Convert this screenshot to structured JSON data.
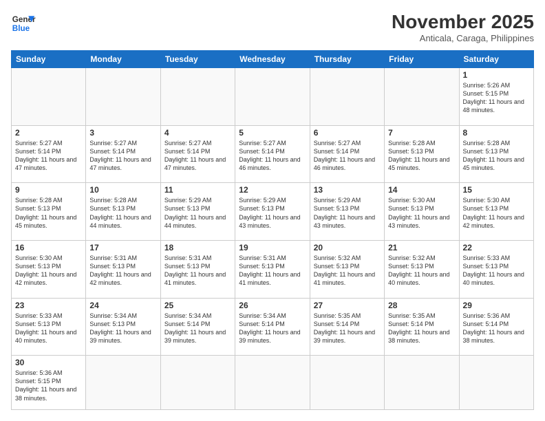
{
  "logo": {
    "line1": "General",
    "line2": "Blue"
  },
  "header": {
    "month": "November 2025",
    "location": "Anticala, Caraga, Philippines"
  },
  "weekdays": [
    "Sunday",
    "Monday",
    "Tuesday",
    "Wednesday",
    "Thursday",
    "Friday",
    "Saturday"
  ],
  "weeks": [
    [
      {
        "day": "",
        "info": ""
      },
      {
        "day": "",
        "info": ""
      },
      {
        "day": "",
        "info": ""
      },
      {
        "day": "",
        "info": ""
      },
      {
        "day": "",
        "info": ""
      },
      {
        "day": "",
        "info": ""
      },
      {
        "day": "1",
        "info": "Sunrise: 5:26 AM\nSunset: 5:15 PM\nDaylight: 11 hours and 48 minutes."
      }
    ],
    [
      {
        "day": "2",
        "info": "Sunrise: 5:27 AM\nSunset: 5:14 PM\nDaylight: 11 hours and 47 minutes."
      },
      {
        "day": "3",
        "info": "Sunrise: 5:27 AM\nSunset: 5:14 PM\nDaylight: 11 hours and 47 minutes."
      },
      {
        "day": "4",
        "info": "Sunrise: 5:27 AM\nSunset: 5:14 PM\nDaylight: 11 hours and 47 minutes."
      },
      {
        "day": "5",
        "info": "Sunrise: 5:27 AM\nSunset: 5:14 PM\nDaylight: 11 hours and 46 minutes."
      },
      {
        "day": "6",
        "info": "Sunrise: 5:27 AM\nSunset: 5:14 PM\nDaylight: 11 hours and 46 minutes."
      },
      {
        "day": "7",
        "info": "Sunrise: 5:28 AM\nSunset: 5:13 PM\nDaylight: 11 hours and 45 minutes."
      },
      {
        "day": "8",
        "info": "Sunrise: 5:28 AM\nSunset: 5:13 PM\nDaylight: 11 hours and 45 minutes."
      }
    ],
    [
      {
        "day": "9",
        "info": "Sunrise: 5:28 AM\nSunset: 5:13 PM\nDaylight: 11 hours and 45 minutes."
      },
      {
        "day": "10",
        "info": "Sunrise: 5:28 AM\nSunset: 5:13 PM\nDaylight: 11 hours and 44 minutes."
      },
      {
        "day": "11",
        "info": "Sunrise: 5:29 AM\nSunset: 5:13 PM\nDaylight: 11 hours and 44 minutes."
      },
      {
        "day": "12",
        "info": "Sunrise: 5:29 AM\nSunset: 5:13 PM\nDaylight: 11 hours and 43 minutes."
      },
      {
        "day": "13",
        "info": "Sunrise: 5:29 AM\nSunset: 5:13 PM\nDaylight: 11 hours and 43 minutes."
      },
      {
        "day": "14",
        "info": "Sunrise: 5:30 AM\nSunset: 5:13 PM\nDaylight: 11 hours and 43 minutes."
      },
      {
        "day": "15",
        "info": "Sunrise: 5:30 AM\nSunset: 5:13 PM\nDaylight: 11 hours and 42 minutes."
      }
    ],
    [
      {
        "day": "16",
        "info": "Sunrise: 5:30 AM\nSunset: 5:13 PM\nDaylight: 11 hours and 42 minutes."
      },
      {
        "day": "17",
        "info": "Sunrise: 5:31 AM\nSunset: 5:13 PM\nDaylight: 11 hours and 42 minutes."
      },
      {
        "day": "18",
        "info": "Sunrise: 5:31 AM\nSunset: 5:13 PM\nDaylight: 11 hours and 41 minutes."
      },
      {
        "day": "19",
        "info": "Sunrise: 5:31 AM\nSunset: 5:13 PM\nDaylight: 11 hours and 41 minutes."
      },
      {
        "day": "20",
        "info": "Sunrise: 5:32 AM\nSunset: 5:13 PM\nDaylight: 11 hours and 41 minutes."
      },
      {
        "day": "21",
        "info": "Sunrise: 5:32 AM\nSunset: 5:13 PM\nDaylight: 11 hours and 40 minutes."
      },
      {
        "day": "22",
        "info": "Sunrise: 5:33 AM\nSunset: 5:13 PM\nDaylight: 11 hours and 40 minutes."
      }
    ],
    [
      {
        "day": "23",
        "info": "Sunrise: 5:33 AM\nSunset: 5:13 PM\nDaylight: 11 hours and 40 minutes."
      },
      {
        "day": "24",
        "info": "Sunrise: 5:34 AM\nSunset: 5:13 PM\nDaylight: 11 hours and 39 minutes."
      },
      {
        "day": "25",
        "info": "Sunrise: 5:34 AM\nSunset: 5:14 PM\nDaylight: 11 hours and 39 minutes."
      },
      {
        "day": "26",
        "info": "Sunrise: 5:34 AM\nSunset: 5:14 PM\nDaylight: 11 hours and 39 minutes."
      },
      {
        "day": "27",
        "info": "Sunrise: 5:35 AM\nSunset: 5:14 PM\nDaylight: 11 hours and 39 minutes."
      },
      {
        "day": "28",
        "info": "Sunrise: 5:35 AM\nSunset: 5:14 PM\nDaylight: 11 hours and 38 minutes."
      },
      {
        "day": "29",
        "info": "Sunrise: 5:36 AM\nSunset: 5:14 PM\nDaylight: 11 hours and 38 minutes."
      }
    ],
    [
      {
        "day": "30",
        "info": "Sunrise: 5:36 AM\nSunset: 5:15 PM\nDaylight: 11 hours and 38 minutes."
      },
      {
        "day": "",
        "info": ""
      },
      {
        "day": "",
        "info": ""
      },
      {
        "day": "",
        "info": ""
      },
      {
        "day": "",
        "info": ""
      },
      {
        "day": "",
        "info": ""
      },
      {
        "day": "",
        "info": ""
      }
    ]
  ]
}
